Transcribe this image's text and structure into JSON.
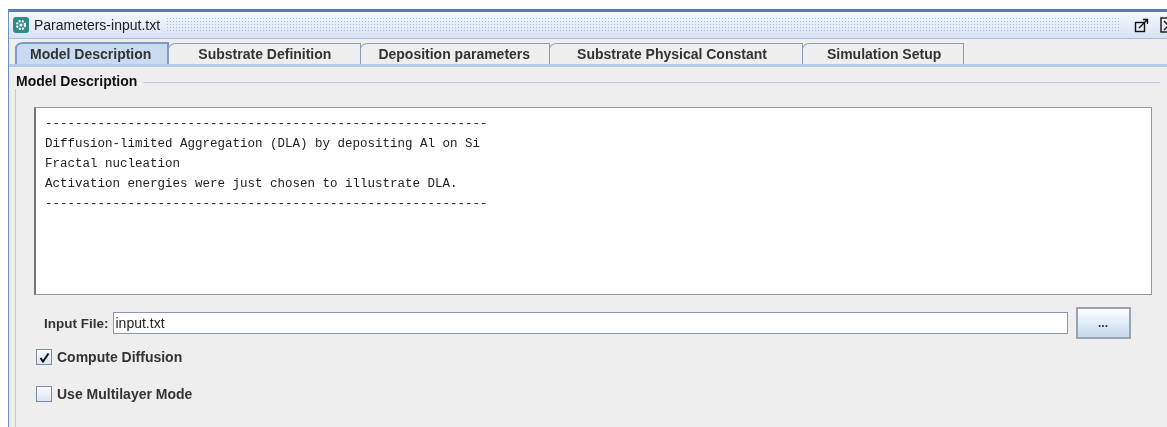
{
  "window": {
    "title": "Parameters-input.txt"
  },
  "tabs": [
    {
      "label": "Model Description",
      "selected": true
    },
    {
      "label": "Substrate Definition",
      "selected": false
    },
    {
      "label": "Deposition parameters",
      "selected": false
    },
    {
      "label": "Substrate Physical Constant",
      "selected": false
    },
    {
      "label": "Simulation Setup",
      "selected": false
    }
  ],
  "group": {
    "title": "Model Description"
  },
  "description_lines": [
    "-----------------------------------------------------------",
    "Diffusion-limited Aggregation (DLA) by depositing Al on Si",
    "Fractal nucleation",
    "Activation energies were just chosen to illustrate DLA.",
    "-----------------------------------------------------------"
  ],
  "input_file": {
    "label": "Input File:",
    "value": "input.txt",
    "browse_button": "..."
  },
  "checkboxes": [
    {
      "label": "Compute Diffusion",
      "checked": true
    },
    {
      "label": "Use Multilayer Mode",
      "checked": false
    }
  ]
}
